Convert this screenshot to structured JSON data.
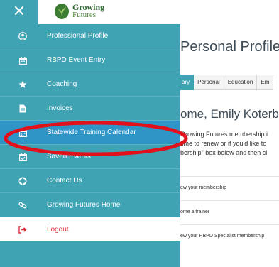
{
  "header": {
    "close_icon": "close-icon",
    "logo": {
      "line1": "Growing",
      "line2": "Futures"
    }
  },
  "page": {
    "title": "Personal Profile",
    "tabs": [
      "ary",
      "Personal",
      "Education",
      "Em"
    ],
    "welcome": "ome, Emily Koterba",
    "blurb_lines": [
      "Growing Futures membership i",
      "time to renew or if you'd like to",
      "bership\" box below and then cl"
    ],
    "links": [
      "ew your membership",
      "ome a trainer",
      "ew your RBPD Specialist membership"
    ]
  },
  "drawer": {
    "items": [
      {
        "label": "Professional Profile",
        "icon": "user-circle-icon"
      },
      {
        "label": "RBPD Event Entry",
        "icon": "calendar-icon"
      },
      {
        "label": "Coaching",
        "icon": "star-icon"
      },
      {
        "label": "Invoices",
        "icon": "document-icon"
      },
      {
        "label": "Statewide Training Calendar",
        "icon": "calendar-icon",
        "active": true
      },
      {
        "label": "Saved Events",
        "icon": "calendar-check-icon"
      },
      {
        "label": "Contact Us",
        "icon": "life-ring-icon"
      },
      {
        "label": "Growing Futures Home",
        "icon": "link-icon"
      },
      {
        "label": "Logout",
        "icon": "sign-out-icon"
      }
    ]
  },
  "colors": {
    "drawer_bg": "#3fa3b4",
    "active_item": "#2f95c7",
    "annotation": "#e0111b",
    "logout_text": "#d8313b"
  }
}
